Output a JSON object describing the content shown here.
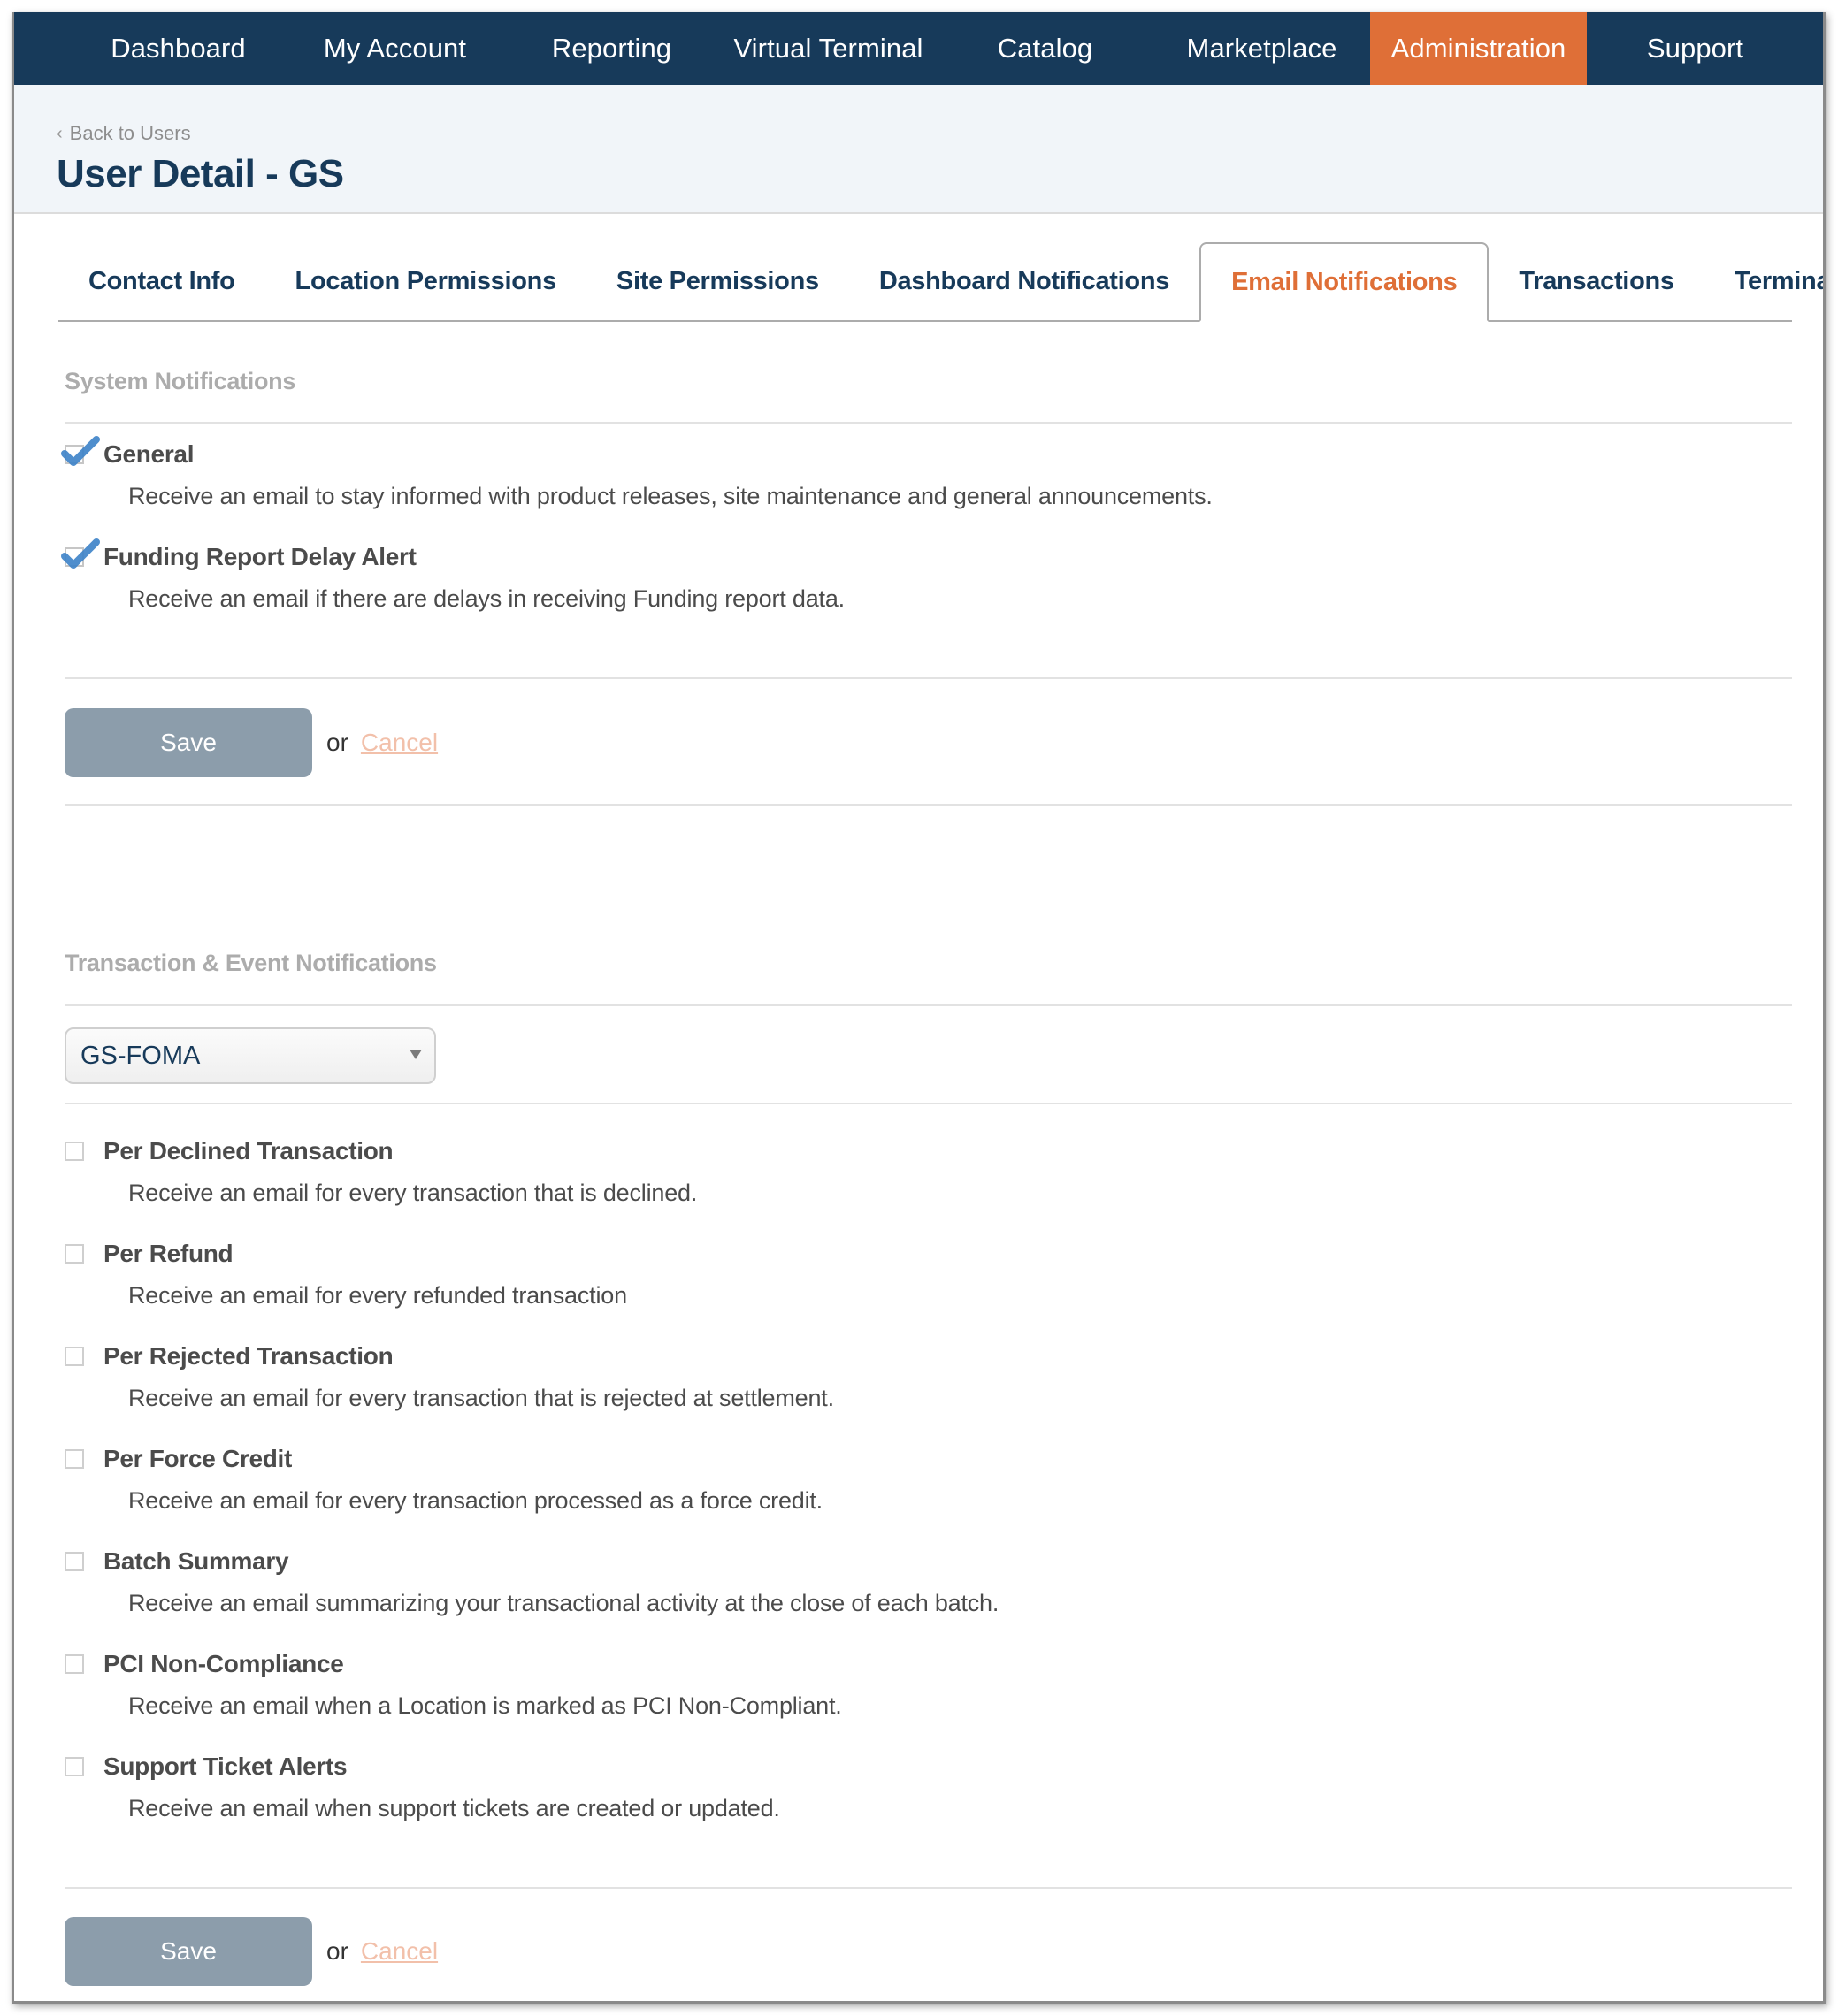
{
  "nav": {
    "items": [
      {
        "label": "Dashboard",
        "active": false
      },
      {
        "label": "My Account",
        "active": false
      },
      {
        "label": "Reporting",
        "active": false
      },
      {
        "label": "Virtual Terminal",
        "active": false
      },
      {
        "label": "Catalog",
        "active": false
      },
      {
        "label": "Marketplace",
        "active": false
      },
      {
        "label": "Administration",
        "active": true
      },
      {
        "label": "Support",
        "active": false
      }
    ]
  },
  "header": {
    "back_label": "Back to Users",
    "back_icon": "chevron-left-icon",
    "title": "User Detail - GS"
  },
  "tabs": [
    {
      "label": "Contact Info",
      "active": false
    },
    {
      "label": "Location Permissions",
      "active": false
    },
    {
      "label": "Site Permissions",
      "active": false
    },
    {
      "label": "Dashboard Notifications",
      "active": false
    },
    {
      "label": "Email Notifications",
      "active": true
    },
    {
      "label": "Transactions",
      "active": false
    },
    {
      "label": "Terminal",
      "active": false
    }
  ],
  "system": {
    "title": "System Notifications",
    "options": [
      {
        "label": "General",
        "checked": true,
        "description": "Receive an email to stay informed with product releases, site maintenance and general announcements."
      },
      {
        "label": "Funding Report Delay Alert",
        "checked": true,
        "description": "Receive an email if there are delays in receiving Funding report data."
      }
    ],
    "save_label": "Save",
    "or_label": "or",
    "cancel_label": "Cancel"
  },
  "transaction": {
    "title": "Transaction & Event Notifications",
    "select_value": "GS-FOMA",
    "options": [
      {
        "label": "Per Declined Transaction",
        "checked": false,
        "description": "Receive an email for every transaction that is declined."
      },
      {
        "label": "Per Refund",
        "checked": false,
        "description": "Receive an email for every refunded transaction"
      },
      {
        "label": "Per Rejected Transaction",
        "checked": false,
        "description": "Receive an email for every transaction that is rejected at settlement."
      },
      {
        "label": "Per Force Credit",
        "checked": false,
        "description": "Receive an email for every transaction processed as a force credit."
      },
      {
        "label": "Batch Summary",
        "checked": false,
        "description": "Receive an email summarizing your transactional activity at the close of each batch."
      },
      {
        "label": "PCI Non-Compliance",
        "checked": false,
        "description": "Receive an email when a Location is marked as PCI Non-Compliant."
      },
      {
        "label": "Support Ticket Alerts",
        "checked": false,
        "description": "Receive an email when support tickets are created or updated."
      }
    ],
    "save_label": "Save",
    "or_label": "or",
    "cancel_label": "Cancel"
  },
  "colors": {
    "nav_bg": "#173a5a",
    "accent": "#df6f37",
    "save_button": "#8c9dab",
    "cancel_link": "#f2c0aa",
    "check_blue": "#3c82c8"
  }
}
